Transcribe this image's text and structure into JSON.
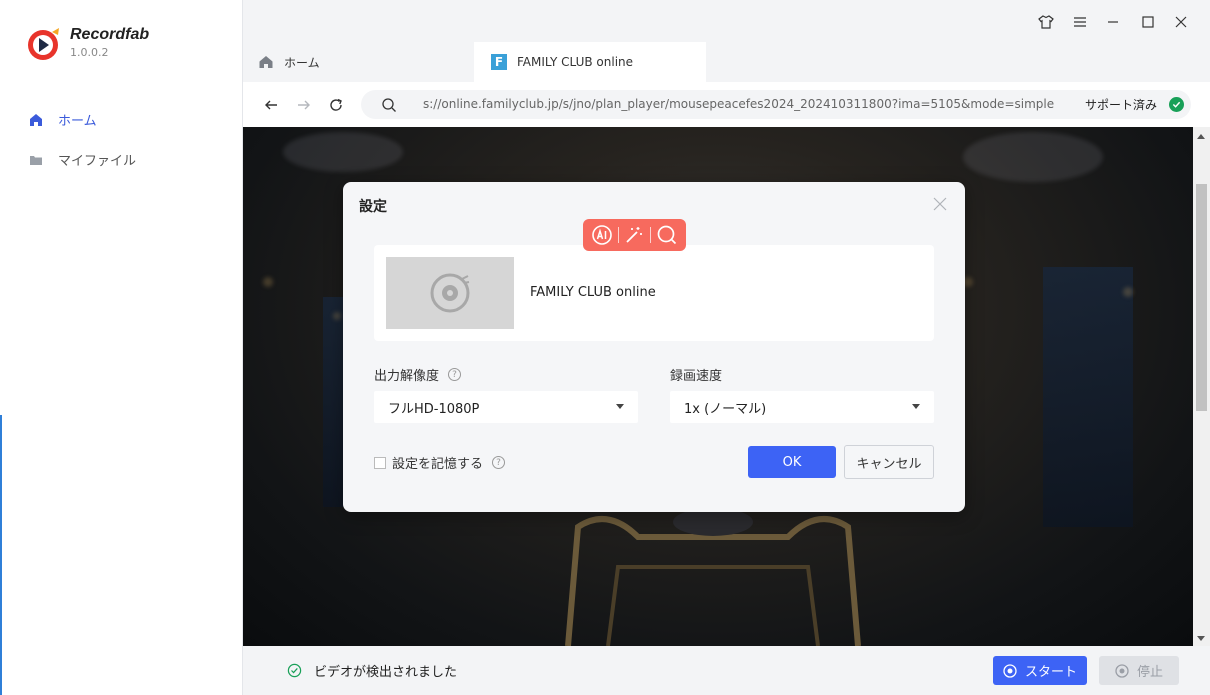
{
  "app": {
    "name": "Recordfab",
    "version": "1.0.0.2"
  },
  "sidebar": {
    "items": [
      {
        "label": "ホーム",
        "icon": "home-icon",
        "active": true
      },
      {
        "label": "マイファイル",
        "icon": "folder-icon",
        "active": false
      }
    ]
  },
  "window_controls": [
    "shirt-icon",
    "menu-icon",
    "minimize-icon",
    "maximize-icon",
    "close-icon"
  ],
  "tabs": [
    {
      "label": "ホーム",
      "icon": "home-icon"
    },
    {
      "label": "FAMILY CLUB online",
      "icon": "f-site-icon",
      "icon_letter": "F",
      "active": true
    }
  ],
  "address_bar": {
    "url": "s://online.familyclub.jp/s/jno/plan_player/mousepeacefes2024_202410311800?ima=5105&mode=simple",
    "status": "サポート済み"
  },
  "dialog": {
    "title": "設定",
    "media_title": "FAMILY CLUB online",
    "resolution_label": "出力解像度",
    "resolution_value": "フルHD-1080P",
    "speed_label": "録画速度",
    "speed_value": "1x (ノーマル)",
    "remember_label": "設定を記憶する",
    "ok_label": "OK",
    "cancel_label": "キャンセル",
    "help_glyph": "?"
  },
  "ai_toolbar": [
    "ai-icon",
    "magic-wand-icon",
    "search-icon"
  ],
  "bottom_bar": {
    "status": "ビデオが検出されました",
    "start_label": "スタート",
    "stop_label": "停止"
  },
  "colors": {
    "accent": "#3d63f5",
    "ai_toolbar": "#f76a5e",
    "success": "#18a058",
    "sidebar_active": "#3b5bdb"
  }
}
